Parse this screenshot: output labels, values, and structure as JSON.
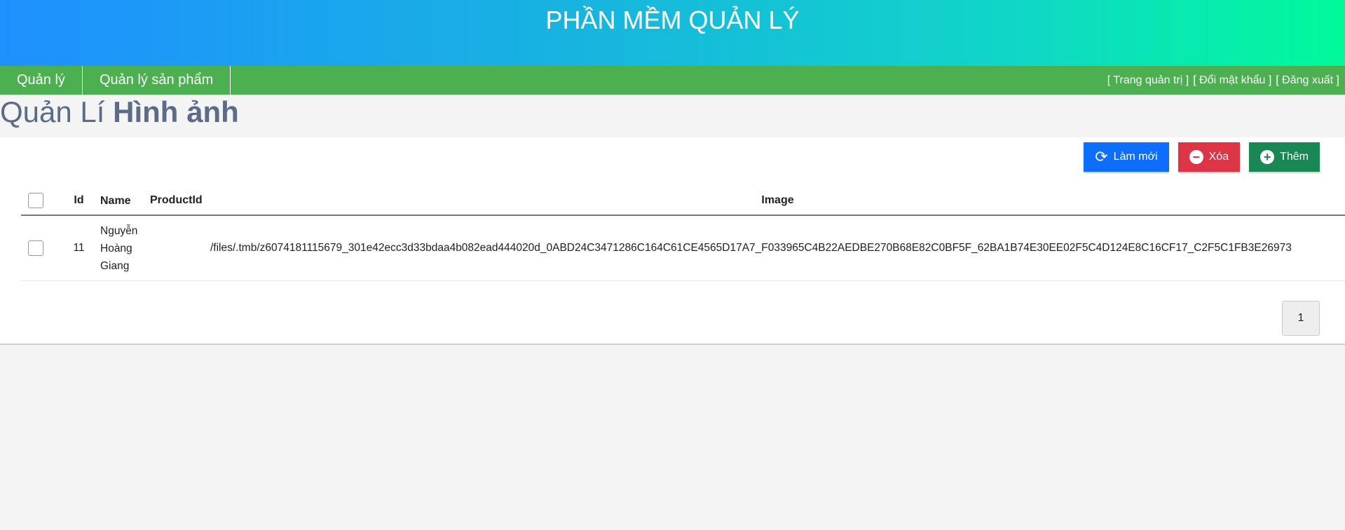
{
  "header": {
    "title": "PHẦN MỀM QUẢN LÝ"
  },
  "nav": {
    "items": [
      {
        "label": "Quản lý"
      },
      {
        "label": "Quản lý sản phẩm"
      }
    ],
    "links": [
      {
        "label": "[ Trang quản trị ]"
      },
      {
        "label": "[ Đổi mật khẩu ]"
      },
      {
        "label": "[ Đăng xuất ]"
      }
    ]
  },
  "page": {
    "title_light": "Quản Lí ",
    "title_bold": "Hình ảnh"
  },
  "toolbar": {
    "refresh_label": "Làm mới",
    "delete_label": "Xóa",
    "add_label": "Thêm",
    "refresh_icon": "refresh-icon",
    "delete_icon": "minus-circle-icon",
    "add_icon": "plus-circle-icon"
  },
  "table": {
    "headers": {
      "id": "Id",
      "name": "Name",
      "product_id": "ProductId",
      "image": "Image"
    },
    "rows": [
      {
        "id": "11",
        "name": "Nguyễn Hoàng Giang",
        "product_id": "",
        "image": "/files/.tmb/z6074181115679_301e42ecc3d33bdaa4b082ead444020d_0ABD24C3471286C164C61CE4565D17A7_F033965C4B22AEDBE270B68E82C0BF5F_62BA1B74E30EE02F5C4D124E8C16CF17_C2F5C1FB3E26973"
      }
    ]
  },
  "pagination": {
    "current": "1"
  },
  "colors": {
    "nav_bg": "#4caf50",
    "refresh": "#0d6efd",
    "delete": "#dc3545",
    "add": "#198754",
    "title": "#5b6b88"
  }
}
